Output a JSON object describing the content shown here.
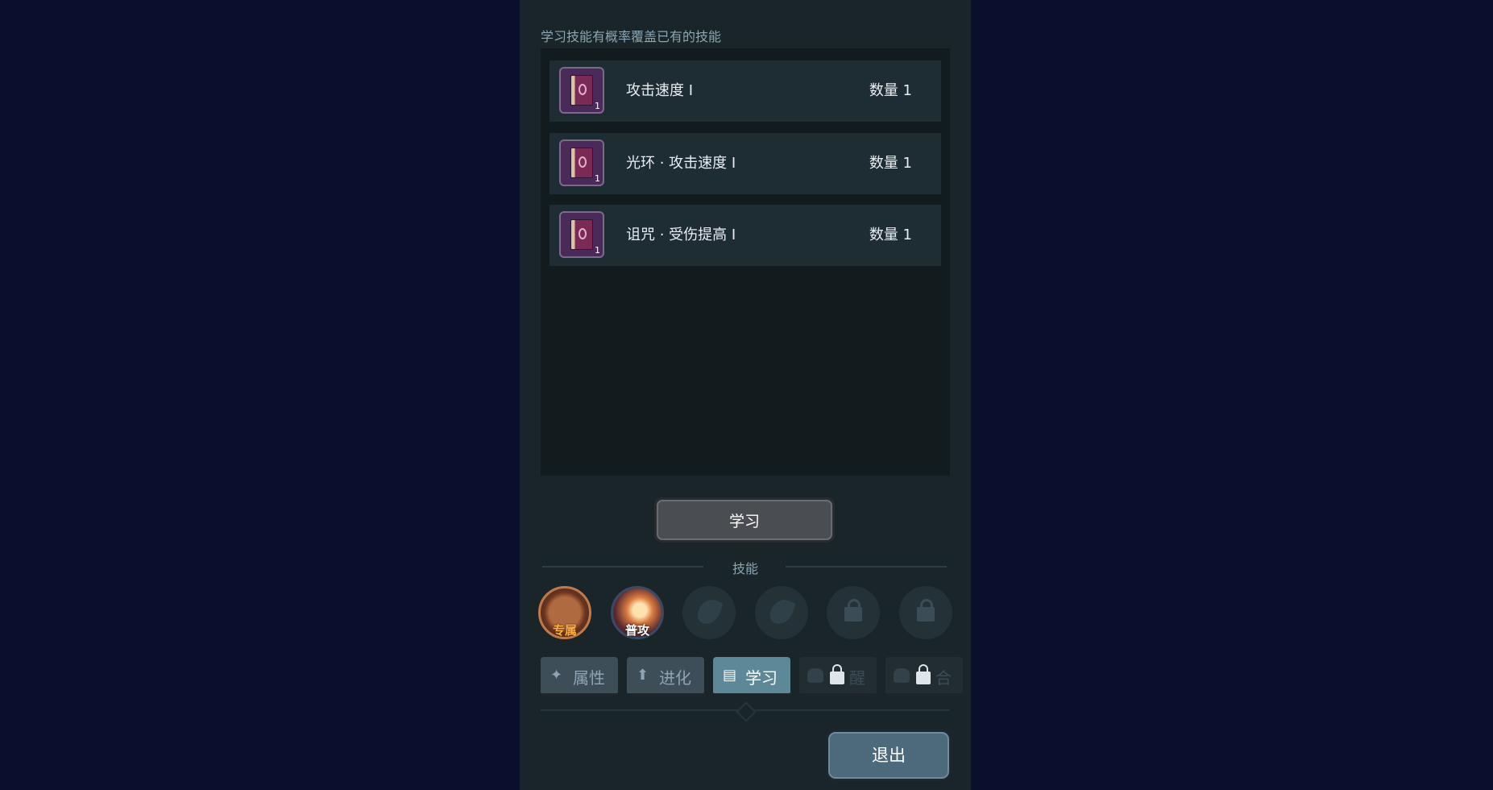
{
  "hint_text": "学习技能有概率覆盖已有的技能",
  "books": [
    {
      "name": "攻击速度 Ⅰ",
      "qty_label": "数量 1",
      "icon": "skill-book-icon",
      "badge": "1"
    },
    {
      "name": "光环 · 攻击速度 Ⅰ",
      "qty_label": "数量 1",
      "icon": "skill-book-icon",
      "badge": "1"
    },
    {
      "name": "诅咒 · 受伤提高 Ⅰ",
      "qty_label": "数量 1",
      "icon": "skill-book-icon",
      "badge": "1"
    }
  ],
  "learn_button": "学习",
  "skills_title": "技能",
  "skill_slots": [
    {
      "type": "exclusive",
      "tag": "专属",
      "icon": "exclusive-skill-icon"
    },
    {
      "type": "normal",
      "tag": "普攻",
      "icon": "normal-attack-icon"
    },
    {
      "type": "empty",
      "icon": "flame-icon"
    },
    {
      "type": "empty",
      "icon": "flame-icon"
    },
    {
      "type": "locked",
      "icon": "lock-icon"
    },
    {
      "type": "locked",
      "icon": "lock-icon"
    }
  ],
  "tabs": [
    {
      "label": "属性",
      "icon": "paw-icon",
      "state": "normal"
    },
    {
      "label": "进化",
      "icon": "arrow-up-icon",
      "state": "normal"
    },
    {
      "label": "学习",
      "icon": "book-icon",
      "state": "active"
    },
    {
      "label": "醒",
      "icon": "lock-icon",
      "state": "locked"
    },
    {
      "label": "合",
      "icon": "lock-icon",
      "state": "locked"
    }
  ],
  "exit_button": "退出",
  "colors": {
    "background": "#0b0f2e",
    "panel": "#1a2529",
    "active_tab": "#5d8898",
    "exclusive_tag": "#ffb040"
  }
}
